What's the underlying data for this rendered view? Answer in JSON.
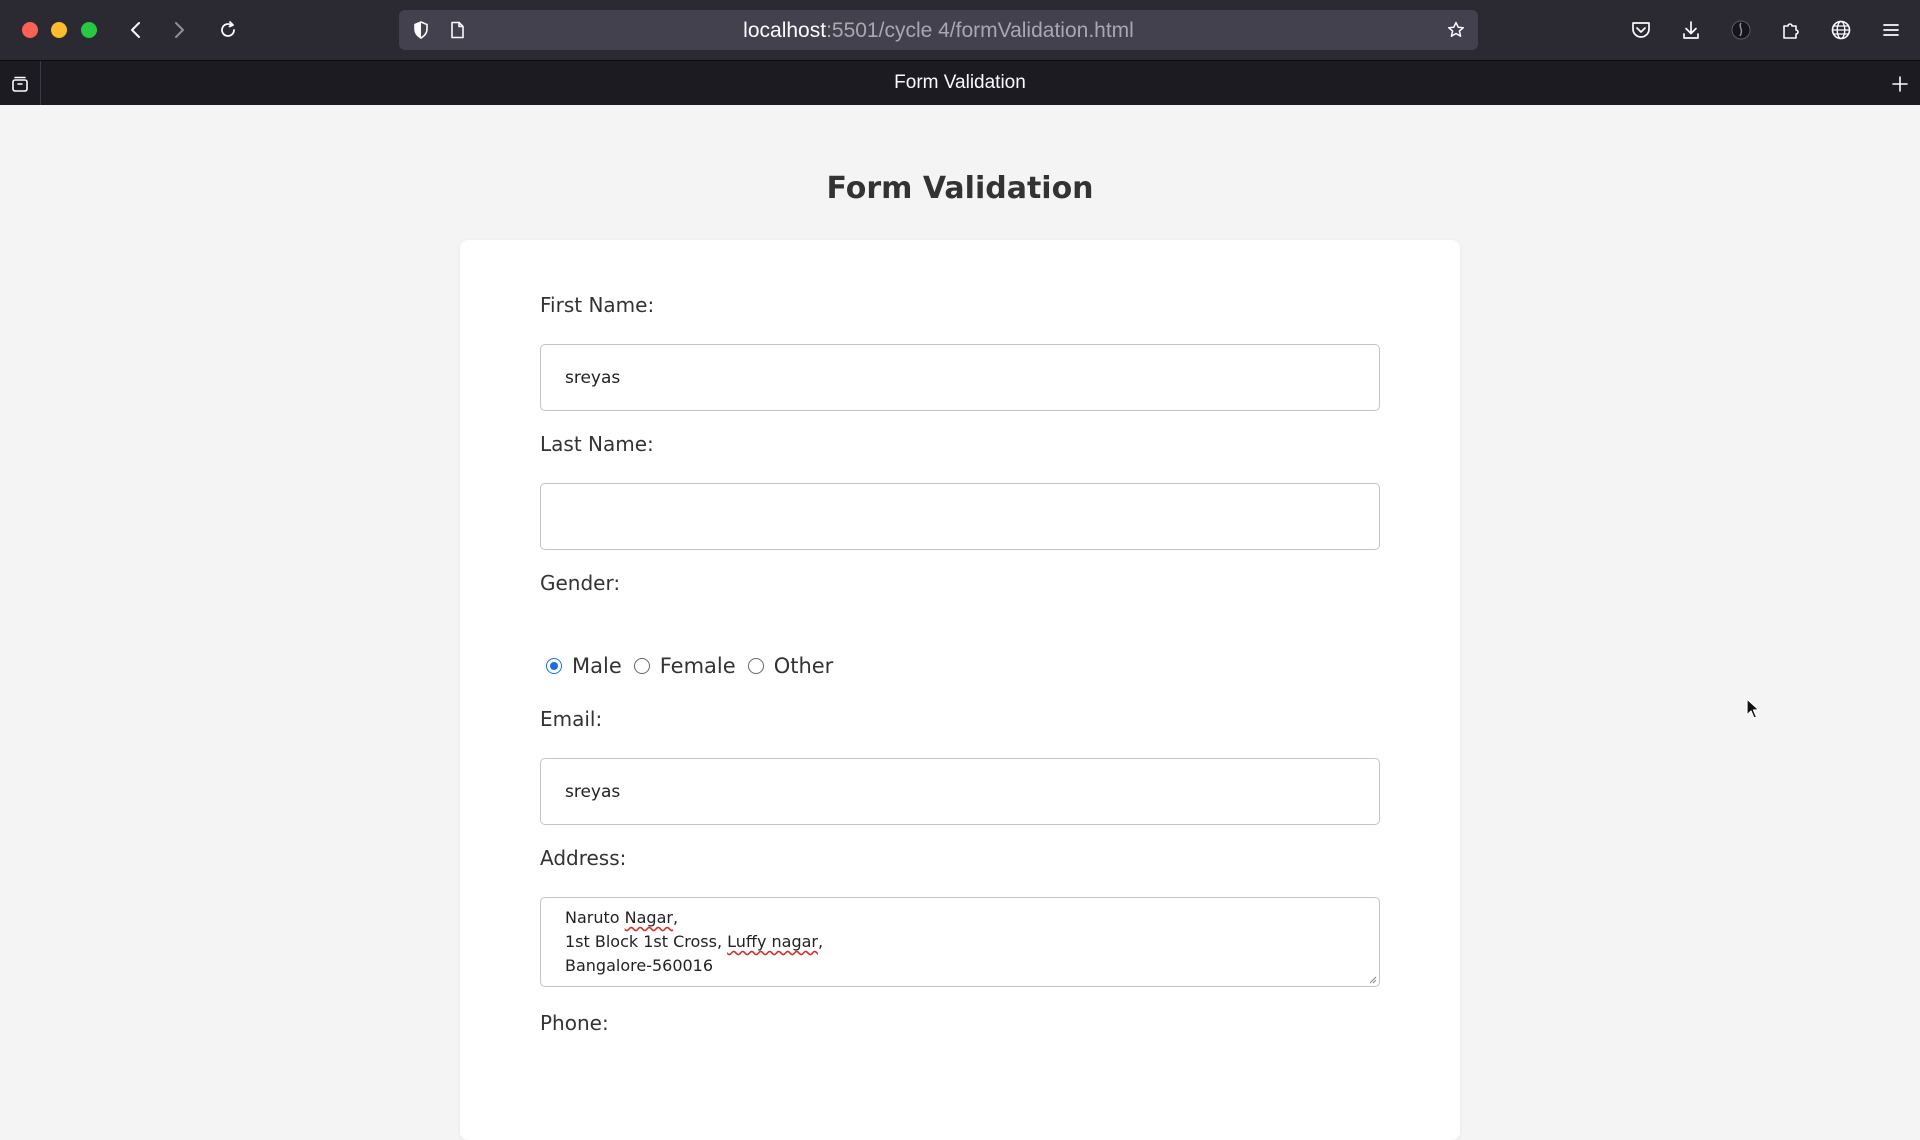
{
  "browser": {
    "url_host": "localhost",
    "url_rest": ":5501/cycle 4/formValidation.html",
    "tab_title": "Form Validation"
  },
  "page": {
    "heading": "Form Validation"
  },
  "form": {
    "first_name_label": "First Name:",
    "first_name_value": "sreyas",
    "last_name_label": "Last Name:",
    "last_name_value": "",
    "gender_label": "Gender:",
    "gender_options": [
      "Male",
      "Female",
      "Other"
    ],
    "gender_selected": "Male",
    "email_label": "Email:",
    "email_value": "sreyas",
    "address_label": "Address:",
    "address_lines": {
      "l1a": "Naruto ",
      "l1b": "Nagar",
      "l1c": ",",
      "l2a": "1st Block 1st Cross, ",
      "l2b": "Luffy nagar",
      "l2c": ",",
      "l3": "Bangalore-560016"
    },
    "phone_label": "Phone:"
  },
  "colors": {
    "accent": "#1e6fd9",
    "chrome_bg": "#2b2a33",
    "page_bg": "#f4f4f4"
  }
}
